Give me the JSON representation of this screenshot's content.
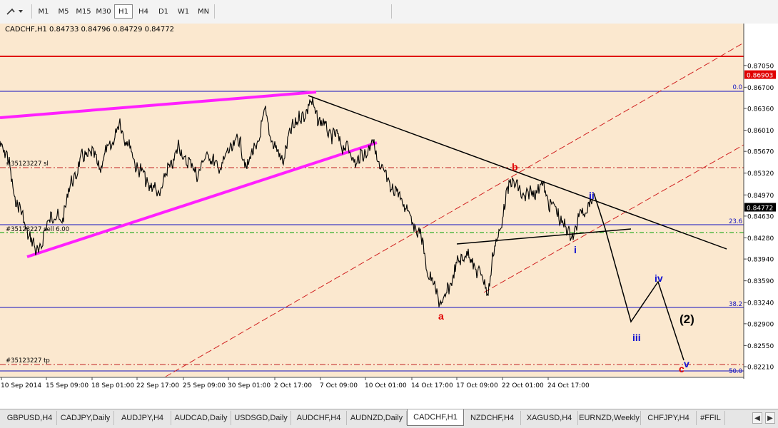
{
  "toolbar": {
    "tool_icon": "line-tool-icon",
    "timeframes": [
      {
        "label": "M1",
        "active": false
      },
      {
        "label": "M5",
        "active": false
      },
      {
        "label": "M15",
        "active": false
      },
      {
        "label": "M30",
        "active": false
      },
      {
        "label": "H1",
        "active": true
      },
      {
        "label": "H4",
        "active": false
      },
      {
        "label": "D1",
        "active": false
      },
      {
        "label": "W1",
        "active": false
      },
      {
        "label": "MN",
        "active": false
      }
    ]
  },
  "chart": {
    "header": "CADCHF,H1  0.84733 0.84796 0.84729 0.84772",
    "y_axis": {
      "min": 0.8205,
      "max": 0.8738,
      "ticks": [
        "0.87050",
        "0.86700",
        "0.86360",
        "0.86010",
        "0.85670",
        "0.85320",
        "0.84970",
        "0.84630",
        "0.84280",
        "0.83940",
        "0.83590",
        "0.83240",
        "0.82900",
        "0.82550",
        "0.82210"
      ]
    },
    "x_axis": {
      "ticks": [
        "10 Sep 2014",
        "15 Sep 09:00",
        "18 Sep 01:00",
        "22 Sep 17:00",
        "25 Sep 09:00",
        "30 Sep 01:00",
        "2 Oct 17:00",
        "7 Oct 09:00",
        "10 Oct 01:00",
        "14 Oct 17:00",
        "17 Oct 09:00",
        "22 Oct 01:00",
        "24 Oct 17:00"
      ]
    },
    "price_labels": {
      "resistance": "0.86903",
      "current": "0.84772"
    },
    "fib_labels": [
      "0.0",
      "23.6",
      "38.2",
      "50.0"
    ],
    "order_labels": {
      "sl": "#35123227 sl",
      "sell": "#35123227 sell 6.00",
      "tp": "#35123227 tp"
    },
    "wave_labels": {
      "a": "a",
      "b": "b",
      "c": "c",
      "i": "i",
      "ii": "ii",
      "iii": "iii",
      "iv": "iv",
      "v": "v",
      "degree": "(2)"
    },
    "colors": {
      "background": "#fbe8cf",
      "price": "#000000",
      "resistance": "#e00000",
      "fib": "#1010c0",
      "channel": "#d02020",
      "magenta": "#ff20ff",
      "order_green": "#00a000",
      "wave_red": "#e00000",
      "wave_blue": "#1010d0"
    }
  },
  "tabs": {
    "items": [
      {
        "label": "GBPUSD,H4",
        "active": false
      },
      {
        "label": "CADJPY,Daily",
        "active": false
      },
      {
        "label": "AUDJPY,H4",
        "active": false
      },
      {
        "label": "AUDCAD,Daily",
        "active": false
      },
      {
        "label": "USDSGD,Daily",
        "active": false
      },
      {
        "label": "AUDCHF,H4",
        "active": false
      },
      {
        "label": "AUDNZD,Daily",
        "active": false
      },
      {
        "label": "CADCHF,H1",
        "active": true
      },
      {
        "label": "NZDCHF,H4",
        "active": false
      },
      {
        "label": "XAGUSD,H4",
        "active": false
      },
      {
        "label": "EURNZD,Weekly",
        "active": false
      },
      {
        "label": "CHFJPY,H4",
        "active": false
      },
      {
        "label": "#FFIL",
        "active": false
      }
    ]
  }
}
